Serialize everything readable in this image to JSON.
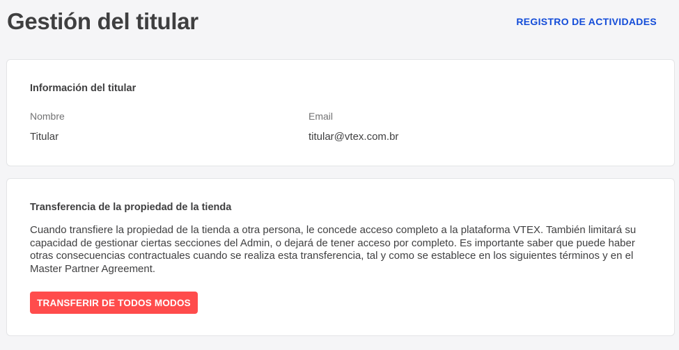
{
  "header": {
    "title": "Gestión del titular",
    "activity_log_link": "REGISTRO DE ACTIVIDADES"
  },
  "owner_info": {
    "heading": "Información del titular",
    "name_label": "Nombre",
    "name_value": "Titular",
    "email_label": "Email",
    "email_value": "titular@vtex.com.br"
  },
  "transfer": {
    "heading": "Transferencia de la propiedad de la tienda",
    "description": "Cuando transfiere la propiedad de la tienda a otra persona, le concede acceso completo a la plataforma VTEX. También limitará su capacidad de gestionar ciertas secciones del Admin, o dejará de tener acceso por completo. Es importante saber que puede haber otras consecuencias contractuales cuando se realiza esta transferencia, tal y como se establece en los siguientes términos y en el Master Partner Agreement.",
    "button_label": "TRANSFERIR DE TODOS MODOS"
  },
  "colors": {
    "link": "#134cd8",
    "danger": "#ff4c4c",
    "background": "#f5f5f7"
  }
}
